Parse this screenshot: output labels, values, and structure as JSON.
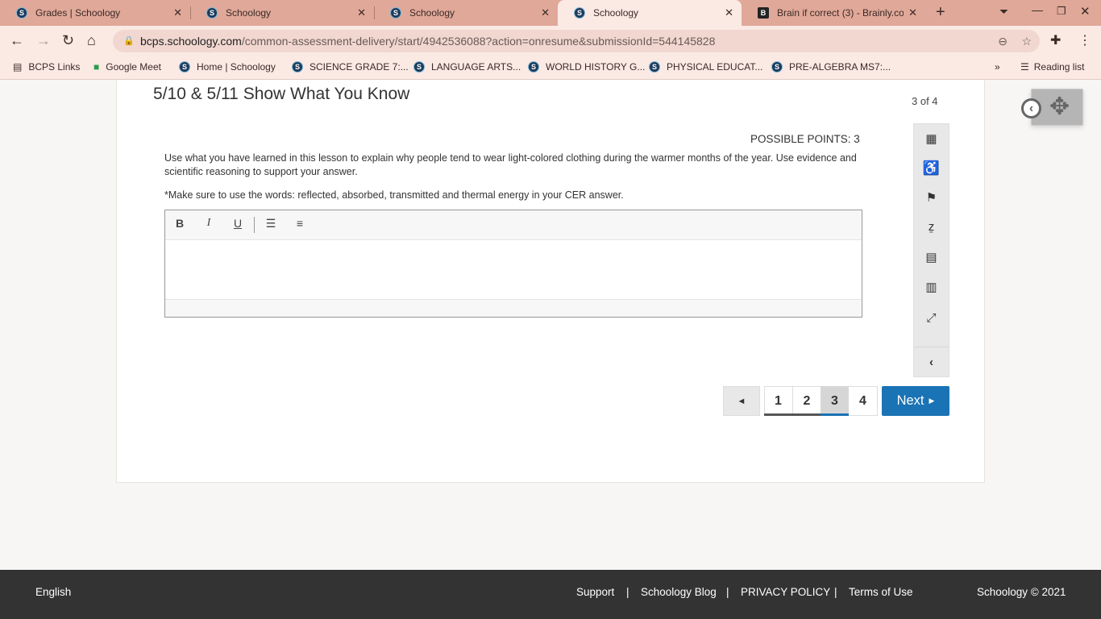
{
  "browser": {
    "tabs": [
      {
        "label": "Grades | Schoology",
        "icon": "S"
      },
      {
        "label": "Schoology",
        "icon": "S"
      },
      {
        "label": "Schoology",
        "icon": "S"
      },
      {
        "label": "Schoology",
        "icon": "S"
      },
      {
        "label": "Brain if correct (3) - Brainly.com",
        "icon": "B"
      }
    ],
    "url_domain": "bcps.schoology.com",
    "url_path": "/common-assessment-delivery/start/4942536088?action=onresume&submissionId=544145828",
    "bookmarks": [
      "BCPS Links",
      "Google Meet",
      "Home | Schoology",
      "SCIENCE GRADE 7:...",
      "LANGUAGE ARTS...",
      "WORLD HISTORY G...",
      "PHYSICAL EDUCAT...",
      "PRE-ALGEBRA MS7:..."
    ],
    "reading_list": "Reading list"
  },
  "assessment": {
    "title": "5/10 & 5/11 Show What You Know",
    "counter": "3 of 4",
    "possible_points": "POSSIBLE POINTS: 3",
    "prompt": "Use what you have learned in this lesson to explain why people tend to wear light-colored clothing during the warmer months of the year.  Use evidence and scientific reasoning to support your answer.",
    "note": "*Make sure to use the words: reflected, absorbed, transmitted and thermal energy in your CER answer.",
    "editor": {
      "bold": "B",
      "italic": "I",
      "underline": "U",
      "answer": ""
    },
    "pages": [
      "1",
      "2",
      "3",
      "4"
    ],
    "current_page": "3",
    "prev": "◄",
    "next": "Next"
  },
  "footer": {
    "language": "English",
    "links": [
      "Support",
      "Schoology Blog",
      "PRIVACY POLICY",
      "Terms of Use"
    ],
    "sep": "|",
    "copyright": "Schoology © 2021"
  },
  "colors": {
    "accent": "#1a73b5",
    "tabbar": "#e0a899",
    "footer": "#333333"
  }
}
